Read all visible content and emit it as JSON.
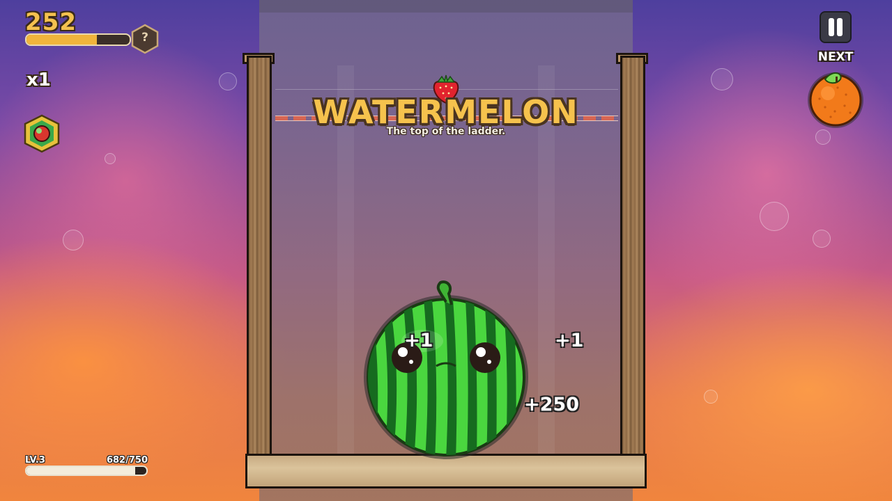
{
  "hud": {
    "score": "252",
    "score_progress": 0.68,
    "mystery_badge": "?",
    "multiplier": "x1",
    "powerup_icon": "fruit-gem-icon",
    "level_label": "LV.3",
    "xp_text": "682/750",
    "xp_progress": 0.909
  },
  "controls": {
    "pause_icon": "pause-icon",
    "next_label": "NEXT",
    "next_fruit": "orange-icon"
  },
  "announcement": {
    "title": "WATERMELON",
    "subtitle": "The top of the ladder."
  },
  "board": {
    "dropping_fruit": "strawberry-icon",
    "merged_fruit": "watermelon-icon",
    "floating_scores": [
      "+1",
      "+1",
      "+250"
    ]
  },
  "colors": {
    "score_gold": "#f4c14f",
    "title_gold": "#f6c24d",
    "deadline_red": "#e2674d",
    "watermelon_green": "#3fc43a"
  }
}
